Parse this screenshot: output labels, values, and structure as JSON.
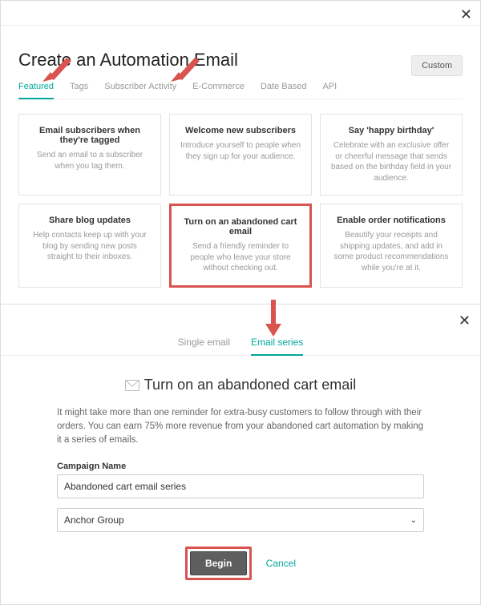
{
  "header": {
    "title": "Create an Automation Email",
    "custom_button": "Custom"
  },
  "tabs": [
    "Featured",
    "Tags",
    "Subscriber Activity",
    "E-Commerce",
    "Date Based",
    "API"
  ],
  "active_tab_index": 0,
  "cards": [
    {
      "title": "Email subscribers when they're tagged",
      "desc": "Send an email to a subscriber when you tag them."
    },
    {
      "title": "Welcome new subscribers",
      "desc": "Introduce yourself to people when they sign up for your audience."
    },
    {
      "title": "Say 'happy birthday'",
      "desc": "Celebrate with an exclusive offer or cheerful message that sends based on the birthday field in your audience."
    },
    {
      "title": "Share blog updates",
      "desc": "Help contacts keep up with your blog by sending new posts straight to their inboxes."
    },
    {
      "title": "Turn on an abandoned cart email",
      "desc": "Send a friendly reminder to people who leave your store without checking out."
    },
    {
      "title": "Enable order notifications",
      "desc": "Beautify your receipts and shipping updates, and add in some product recommendations while you're at it."
    }
  ],
  "highlight_card_index": 4,
  "step2": {
    "mini_tabs": [
      "Single email",
      "Email series"
    ],
    "active_mini_tab_index": 1,
    "heading": "Turn on an abandoned cart email",
    "description": "It might take more than one reminder for extra-busy customers to follow through with their orders. You can earn 75% more revenue from your abandoned cart automation by making it a series of emails.",
    "campaign_label": "Campaign Name",
    "campaign_value": "Abandoned cart email series",
    "audience_value": "Anchor Group",
    "begin_label": "Begin",
    "cancel_label": "Cancel"
  }
}
